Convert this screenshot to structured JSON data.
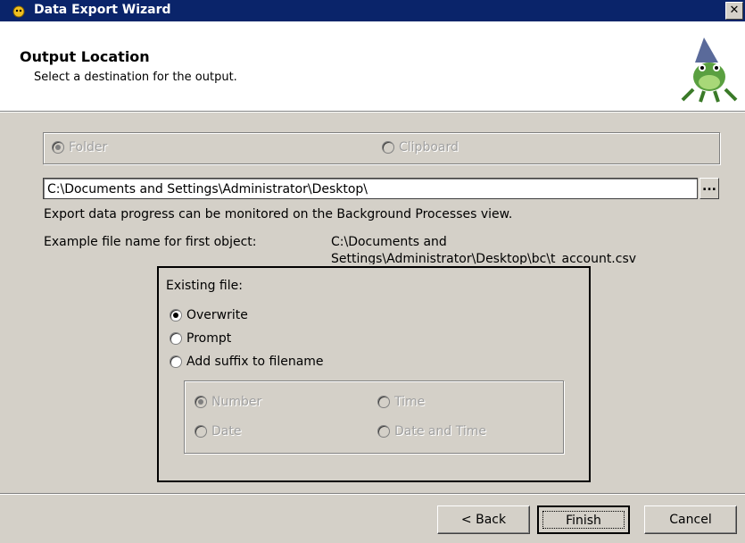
{
  "window": {
    "title": "Data Export Wizard",
    "close_glyph": "✕"
  },
  "header": {
    "title": "Output Location",
    "subtitle": "Select a destination for the output."
  },
  "destination": {
    "folder_label": "Folder",
    "clipboard_label": "Clipboard",
    "selected": "Folder",
    "enabled": false
  },
  "path": {
    "value": "C:\\Documents and Settings\\Administrator\\Desktop\\",
    "browse_label": "..."
  },
  "info": {
    "progress_note": "Export data progress can be monitored on the Background Processes view.",
    "example_label": "Example file name for first object:",
    "example_value_line1": "C:\\Documents and",
    "example_value_line2": "Settings\\Administrator\\Desktop\\bc\\t_account.csv"
  },
  "existing_file": {
    "label": "Existing file:",
    "options": [
      "Overwrite",
      "Prompt",
      "Add suffix to filename"
    ],
    "selected": "Overwrite"
  },
  "suffix": {
    "options": [
      "Number",
      "Time",
      "Date",
      "Date and Time"
    ],
    "selected": "Number",
    "enabled": false
  },
  "buttons": {
    "back": "< Back",
    "finish": "Finish",
    "cancel": "Cancel"
  }
}
